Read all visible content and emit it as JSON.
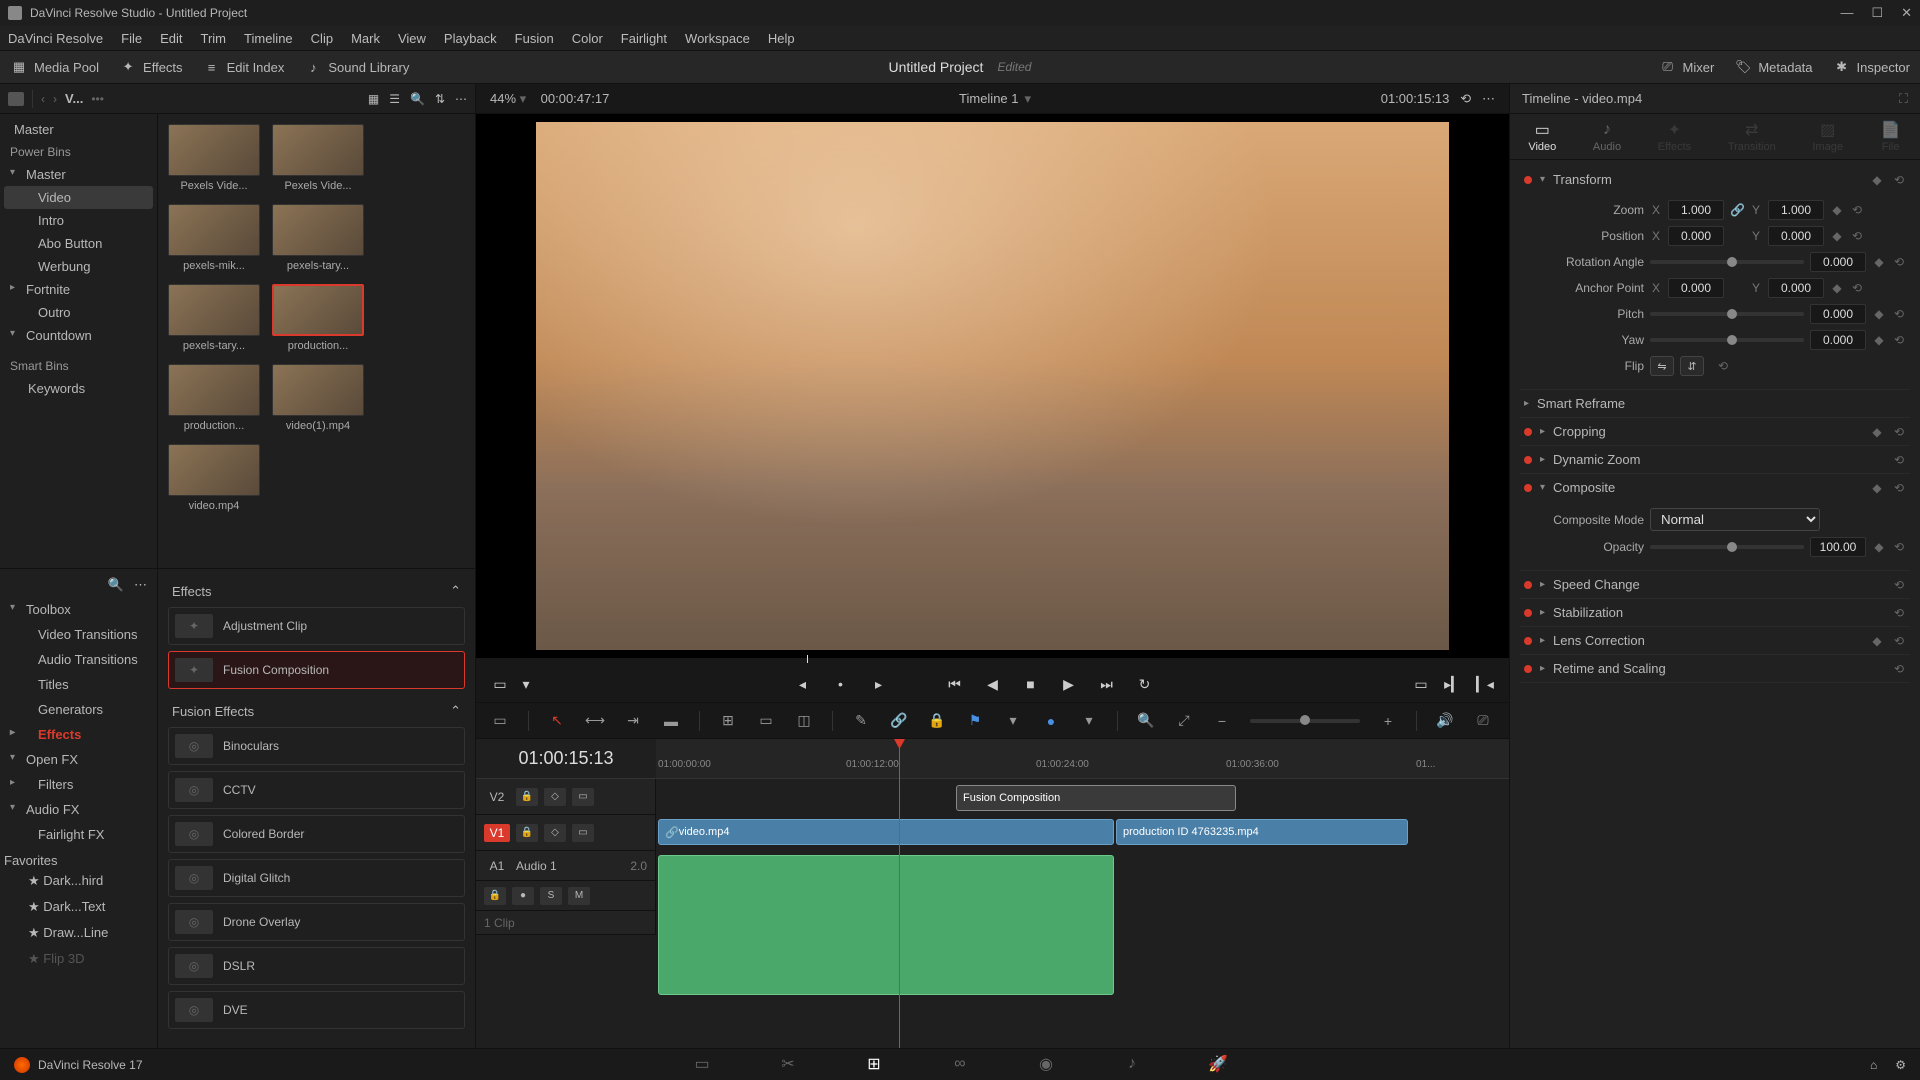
{
  "titlebar": {
    "title": "DaVinci Resolve Studio - Untitled Project"
  },
  "menubar": [
    "DaVinci Resolve",
    "File",
    "Edit",
    "Trim",
    "Timeline",
    "Clip",
    "Mark",
    "View",
    "Playback",
    "Fusion",
    "Color",
    "Fairlight",
    "Workspace",
    "Help"
  ],
  "toolbar": {
    "media_pool": "Media Pool",
    "effects": "Effects",
    "edit_index": "Edit Index",
    "sound_lib": "Sound Library",
    "project": "Untitled Project",
    "edited": "Edited",
    "mixer": "Mixer",
    "metadata": "Metadata",
    "inspector": "Inspector"
  },
  "media": {
    "view_label": "V...",
    "zoom": "44%",
    "src_tc": "00:00:47:17",
    "master": "Master",
    "power_bins": "Power Bins",
    "bins": [
      "Master",
      "Video",
      "Intro",
      "Abo Button",
      "Werbung",
      "Fortnite",
      "Outro",
      "Countdown"
    ],
    "smart_bins": "Smart Bins",
    "keywords": "Keywords",
    "clips": [
      {
        "name": "Pexels Vide..."
      },
      {
        "name": "Pexels Vide..."
      },
      {
        "name": "pexels-mik..."
      },
      {
        "name": "pexels-tary..."
      },
      {
        "name": "pexels-tary..."
      },
      {
        "name": "production...",
        "sel": true
      },
      {
        "name": "production..."
      },
      {
        "name": "video(1).mp4"
      },
      {
        "name": "video.mp4"
      }
    ]
  },
  "fx": {
    "nav": [
      "Toolbox",
      "Video Transitions",
      "Audio Transitions",
      "Titles",
      "Generators",
      "Effects",
      "Open FX",
      "Filters",
      "Audio FX",
      "Fairlight FX"
    ],
    "favorites": "Favorites",
    "fav_items": [
      "Dark...hird",
      "Dark...Text",
      "Draw...Line",
      "Flip 3D"
    ],
    "section1": "Effects",
    "effects": [
      {
        "name": "Adjustment Clip"
      },
      {
        "name": "Fusion Composition",
        "sel": true
      }
    ],
    "section2": "Fusion Effects",
    "fusion": [
      "Binoculars",
      "CCTV",
      "Colored Border",
      "Digital Glitch",
      "Drone Overlay",
      "DSLR",
      "DVE"
    ]
  },
  "viewer": {
    "timeline_name": "Timeline 1",
    "record_tc": "01:00:15:13"
  },
  "timeline": {
    "tc": "01:00:15:13",
    "ticks": [
      "01:00:00:00",
      "01:00:12:00",
      "01:00:24:00",
      "01:00:36:00",
      "01..."
    ],
    "v2": "V2",
    "v1": "V1",
    "a1": "A1",
    "a1_name": "Audio 1",
    "a1_ch": "2.0",
    "a1_sub": "1 Clip",
    "clip_fusion": "Fusion Composition",
    "clip_v1a": "video.mp4",
    "clip_v1b": "production ID 4763235.mp4",
    "mute": "M",
    "solo": "S"
  },
  "inspector": {
    "title": "Timeline - video.mp4",
    "tabs": [
      "Video",
      "Audio",
      "Effects",
      "Transition",
      "Image",
      "File"
    ],
    "transform": "Transform",
    "zoom": "Zoom",
    "zoom_x": "1.000",
    "zoom_y": "1.000",
    "position": "Position",
    "pos_x": "0.000",
    "pos_y": "0.000",
    "rotation": "Rotation Angle",
    "rot_v": "0.000",
    "anchor": "Anchor Point",
    "an_x": "0.000",
    "an_y": "0.000",
    "pitch": "Pitch",
    "pitch_v": "0.000",
    "yaw": "Yaw",
    "yaw_v": "0.000",
    "flip": "Flip",
    "smart_reframe": "Smart Reframe",
    "cropping": "Cropping",
    "dyn_zoom": "Dynamic Zoom",
    "composite": "Composite",
    "comp_mode": "Composite Mode",
    "comp_normal": "Normal",
    "opacity": "Opacity",
    "opacity_v": "100.00",
    "speed": "Speed Change",
    "stab": "Stabilization",
    "lens": "Lens Correction",
    "retime": "Retime and Scaling"
  },
  "bottombar": {
    "label": "DaVinci Resolve 17"
  }
}
